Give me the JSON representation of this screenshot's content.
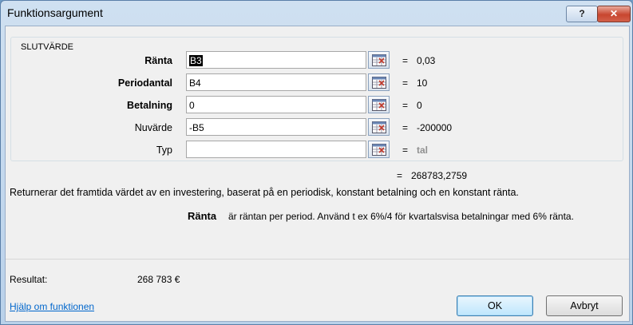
{
  "window": {
    "title": "Funktionsargument",
    "help_btn": "?",
    "close_btn": "✕"
  },
  "group": {
    "title": "SLUTVÄRDE"
  },
  "args": [
    {
      "label": "Ränta",
      "value_prefix": "",
      "value_selected": "B3",
      "result": "0,03"
    },
    {
      "label": "Periodantal",
      "value": "B4",
      "result": "10"
    },
    {
      "label": "Betalning",
      "value": "0",
      "result": "0"
    },
    {
      "label": "Nuvärde",
      "value": "-B5",
      "result": "-200000"
    },
    {
      "label": "Typ",
      "value": "",
      "result": "tal"
    }
  ],
  "equals": "=",
  "formula_result": "268783,2759",
  "description": "Returnerar det framtida värdet av en investering, baserat på en periodisk, konstant betalning och en konstant ränta.",
  "arg_help": {
    "name": "Ränta",
    "text": "är räntan per period. Använd t ex 6%/4 för kvartalsvisa betalningar med 6% ränta."
  },
  "result": {
    "label": "Resultat:",
    "value": "268 783 €"
  },
  "help_link": "Hjälp om funktionen",
  "buttons": {
    "ok": "OK",
    "cancel": "Avbryt"
  }
}
